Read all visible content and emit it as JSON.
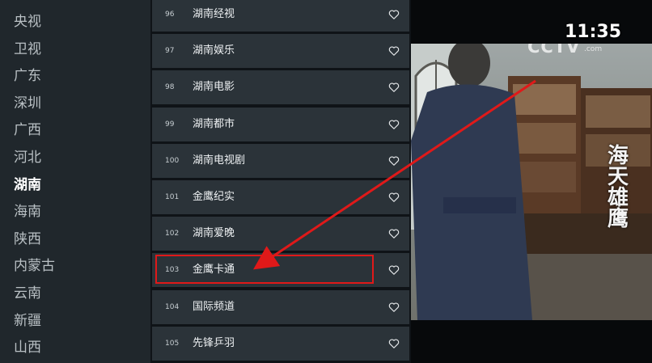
{
  "provinces": [
    {
      "label": "央视"
    },
    {
      "label": "卫视"
    },
    {
      "label": "广东"
    },
    {
      "label": "深圳"
    },
    {
      "label": "广西"
    },
    {
      "label": "河北"
    },
    {
      "label": "湖南",
      "selected": true
    },
    {
      "label": "海南"
    },
    {
      "label": "陕西"
    },
    {
      "label": "内蒙古"
    },
    {
      "label": "云南"
    },
    {
      "label": "新疆"
    },
    {
      "label": "山西"
    }
  ],
  "channels": [
    {
      "number": "96",
      "name": "湖南经视"
    },
    {
      "number": "97",
      "name": "湖南娱乐"
    },
    {
      "number": "98",
      "name": "湖南电影"
    },
    {
      "number": "99",
      "name": "湖南都市"
    },
    {
      "number": "100",
      "name": "湖南电视剧"
    },
    {
      "number": "101",
      "name": "金鹰纪实"
    },
    {
      "number": "102",
      "name": "湖南爱晚"
    },
    {
      "number": "103",
      "name": "金鹰卡通",
      "highlighted": true
    },
    {
      "number": "104",
      "name": "国际频道"
    },
    {
      "number": "105",
      "name": "先锋乒羽"
    }
  ],
  "player": {
    "clock": "11:35",
    "channel_logo": "CCTV",
    "channel_logo_suffix": ".com",
    "drama_title": "海天雄鹰"
  },
  "colors": {
    "highlight": "#e01919",
    "arrow": "#e01919",
    "selected_province": "#ffffff"
  },
  "icons": {
    "favorite": "heart-outline-icon"
  }
}
